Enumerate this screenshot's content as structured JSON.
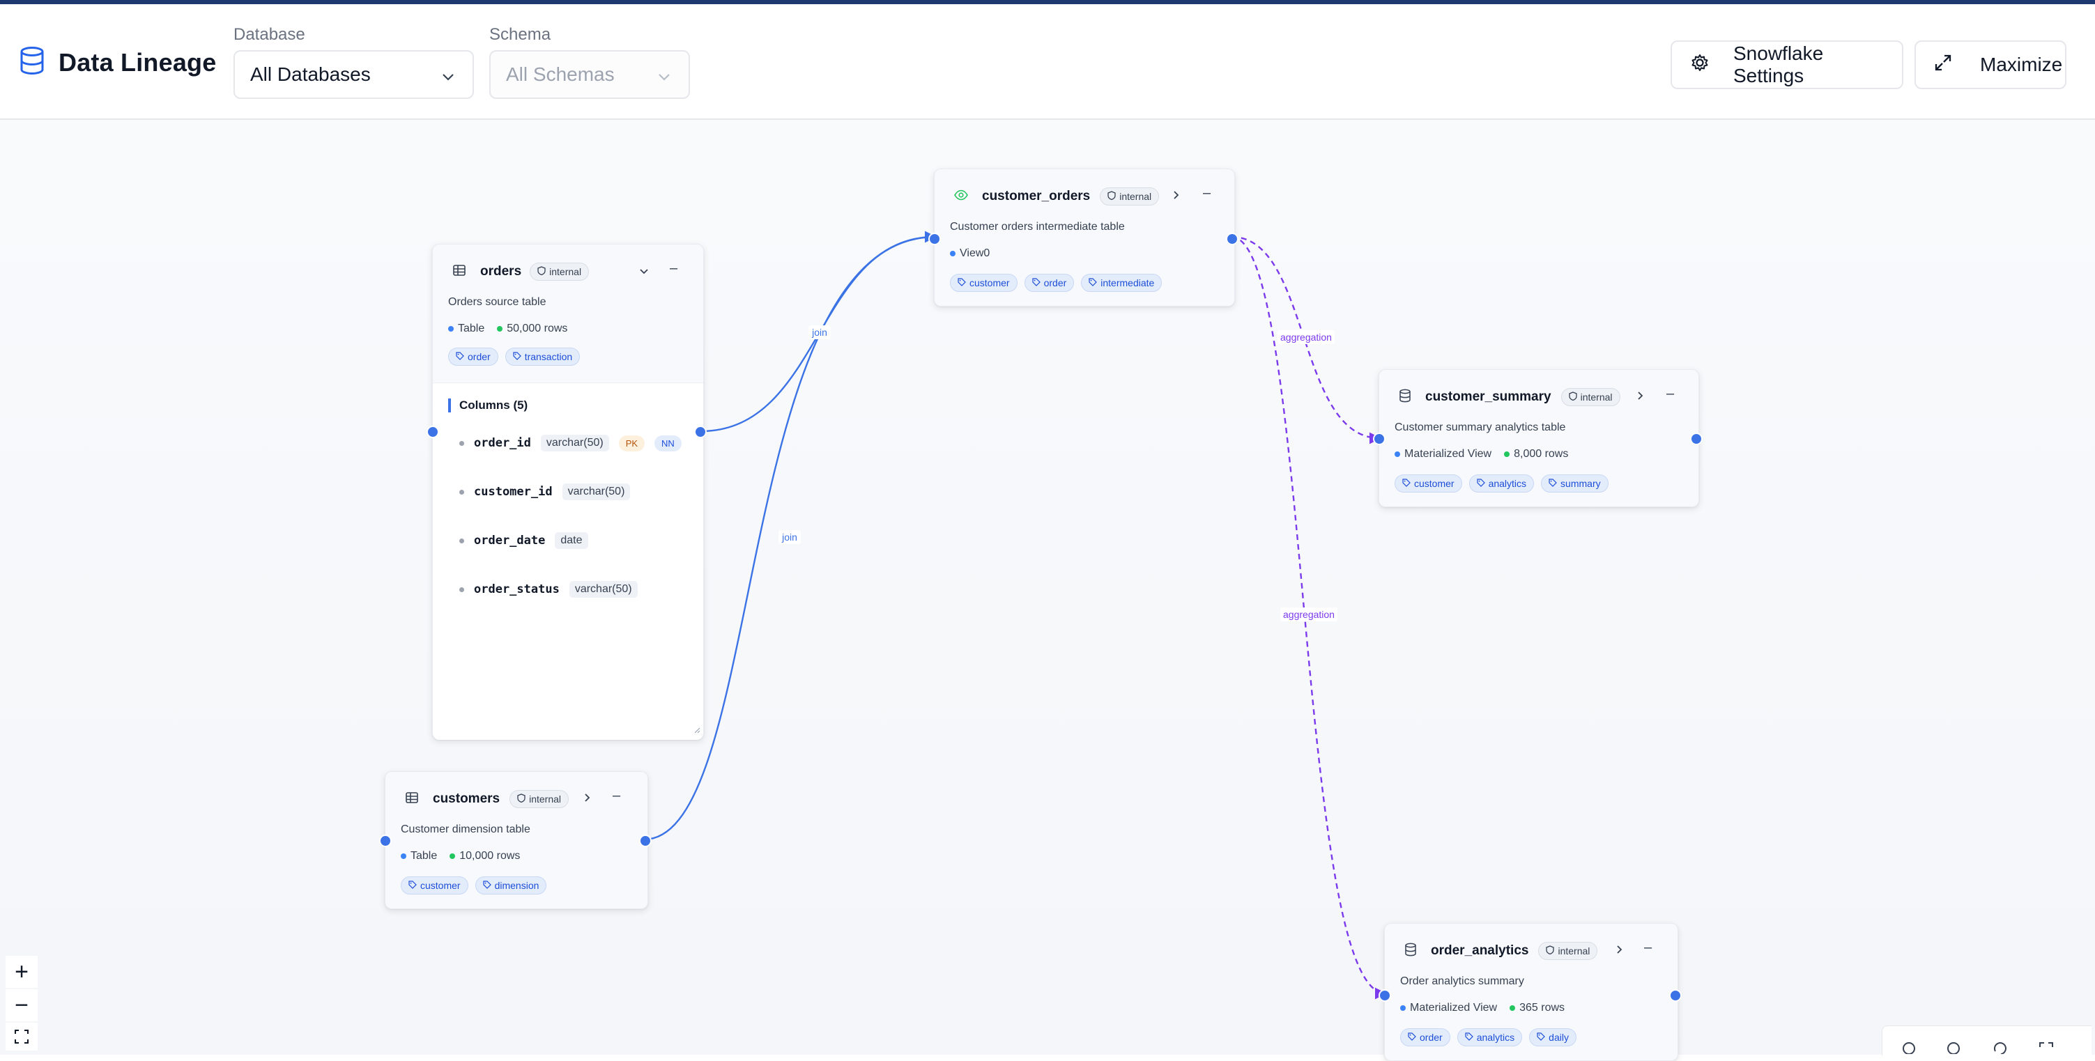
{
  "header": {
    "app_title": "Data Lineage",
    "database_label": "Database",
    "database_value": "All Databases",
    "schema_label": "Schema",
    "schema_value": "All Schemas",
    "settings_button": "Snowflake Settings",
    "maximize_button": "Maximize"
  },
  "colors": {
    "accent": "#3b73e6",
    "edge_join": "#3b73e6",
    "edge_aggregation": "#7c3aed",
    "row_count_dot": "#22c55e",
    "tag_text": "#1d4ed8"
  },
  "nodes": {
    "orders": {
      "icon": "table-icon",
      "name": "orders",
      "badge": "internal",
      "description": "Orders source table",
      "type": "Table",
      "rows": "50,000 rows",
      "tags": [
        "order",
        "transaction"
      ],
      "columns_header": "Columns (5)",
      "columns": [
        {
          "name": "order_id",
          "type": "varchar(50)",
          "pk": "PK",
          "nn": "NN"
        },
        {
          "name": "customer_id",
          "type": "varchar(50)"
        },
        {
          "name": "order_date",
          "type": "date"
        },
        {
          "name": "order_status",
          "type": "varchar(50)"
        }
      ]
    },
    "customer_orders": {
      "icon": "eye-icon",
      "name": "customer_orders",
      "badge": "internal",
      "description": "Customer orders intermediate table",
      "type": "View0",
      "tags": [
        "customer",
        "order",
        "intermediate"
      ]
    },
    "customer_summary": {
      "icon": "database-icon",
      "name": "customer_summary",
      "badge": "internal",
      "description": "Customer summary analytics table",
      "type": "Materialized View",
      "rows": "8,000 rows",
      "tags": [
        "customer",
        "analytics",
        "summary"
      ]
    },
    "customers": {
      "icon": "table-icon",
      "name": "customers",
      "badge": "internal",
      "description": "Customer dimension table",
      "type": "Table",
      "rows": "10,000 rows",
      "tags": [
        "customer",
        "dimension"
      ]
    },
    "order_analytics": {
      "icon": "database-icon",
      "name": "order_analytics",
      "badge": "internal",
      "description": "Order analytics summary",
      "type": "Materialized View",
      "rows": "365 rows",
      "tags": [
        "order",
        "analytics",
        "daily"
      ]
    }
  },
  "edges": [
    {
      "from": "orders",
      "to": "customer_orders",
      "label": "join",
      "style": "solid"
    },
    {
      "from": "customers",
      "to": "customer_orders",
      "label": "join",
      "style": "solid"
    },
    {
      "from": "customer_orders",
      "to": "customer_summary",
      "label": "aggregation",
      "style": "dashed"
    },
    {
      "from": "customer_orders",
      "to": "order_analytics",
      "label": "aggregation",
      "style": "dashed"
    }
  ],
  "controls": {
    "zoom_in": "+",
    "zoom_out": "−"
  }
}
